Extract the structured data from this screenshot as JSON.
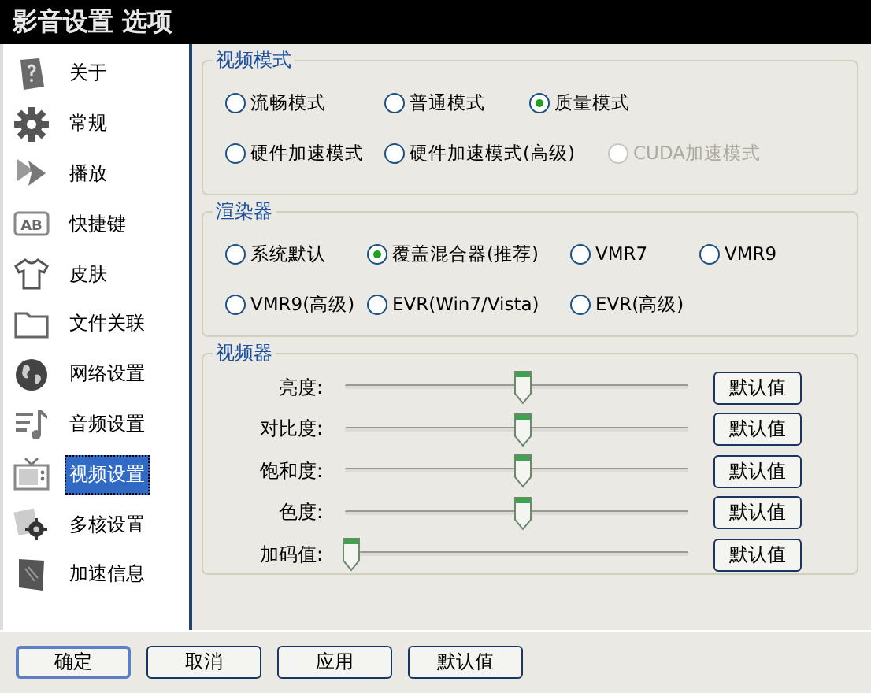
{
  "window": {
    "title": "影音设置 选项"
  },
  "sidebar": {
    "items": [
      {
        "label": "关于",
        "kind": "about",
        "selected": false
      },
      {
        "label": "常规",
        "kind": "gear",
        "selected": false
      },
      {
        "label": "播放",
        "kind": "play",
        "selected": false
      },
      {
        "label": "快捷键",
        "kind": "keycap",
        "icon_text": "AB",
        "selected": false
      },
      {
        "label": "皮肤",
        "kind": "shirt",
        "selected": false
      },
      {
        "label": "文件关联",
        "kind": "folder",
        "selected": false
      },
      {
        "label": "网络设置",
        "kind": "globe",
        "selected": false
      },
      {
        "label": "音频设置",
        "kind": "music",
        "selected": false
      },
      {
        "label": "视频设置",
        "kind": "tv",
        "selected": true
      },
      {
        "label": "多核设置",
        "kind": "cores",
        "selected": false
      },
      {
        "label": "加速信息",
        "kind": "card",
        "selected": false
      }
    ]
  },
  "video_mode": {
    "title": "视频模式",
    "rows": [
      [
        {
          "label": "流畅模式",
          "selected": false,
          "disabled": false
        },
        {
          "label": "普通模式",
          "selected": false,
          "disabled": false
        },
        {
          "label": "质量模式",
          "selected": true,
          "disabled": false
        }
      ],
      [
        {
          "label": "硬件加速模式",
          "selected": false,
          "disabled": false
        },
        {
          "label": "硬件加速模式(高级)",
          "selected": false,
          "disabled": false
        },
        {
          "label": "CUDA加速模式",
          "selected": false,
          "disabled": true
        }
      ]
    ]
  },
  "renderer": {
    "title": "渲染器",
    "rows": [
      [
        {
          "label": "系统默认",
          "selected": false,
          "disabled": false
        },
        {
          "label": "覆盖混合器(推荐)",
          "selected": true,
          "disabled": false
        },
        {
          "label": "VMR7",
          "selected": false,
          "disabled": false
        },
        {
          "label": "VMR9",
          "selected": false,
          "disabled": false
        }
      ],
      [
        {
          "label": "VMR9(高级)",
          "selected": false,
          "disabled": false
        },
        {
          "label": "EVR(Win7/Vista)",
          "selected": false,
          "disabled": false
        },
        {
          "label": "EVR(高级)",
          "selected": false,
          "disabled": false
        }
      ]
    ]
  },
  "video": {
    "title": "视频器",
    "sliders": [
      {
        "label": "亮度:",
        "level": 0.5,
        "button": "默认值"
      },
      {
        "label": "对比度:",
        "level": 0.5,
        "button": "默认值"
      },
      {
        "label": "饱和度:",
        "level": 0.5,
        "button": "默认值"
      },
      {
        "label": "色度:",
        "level": 0.5,
        "button": "默认值"
      },
      {
        "label": "加码值:",
        "level": 0,
        "button": "默认值"
      }
    ]
  },
  "buttons": [
    "确定",
    "取消",
    "应用",
    "默认值"
  ]
}
